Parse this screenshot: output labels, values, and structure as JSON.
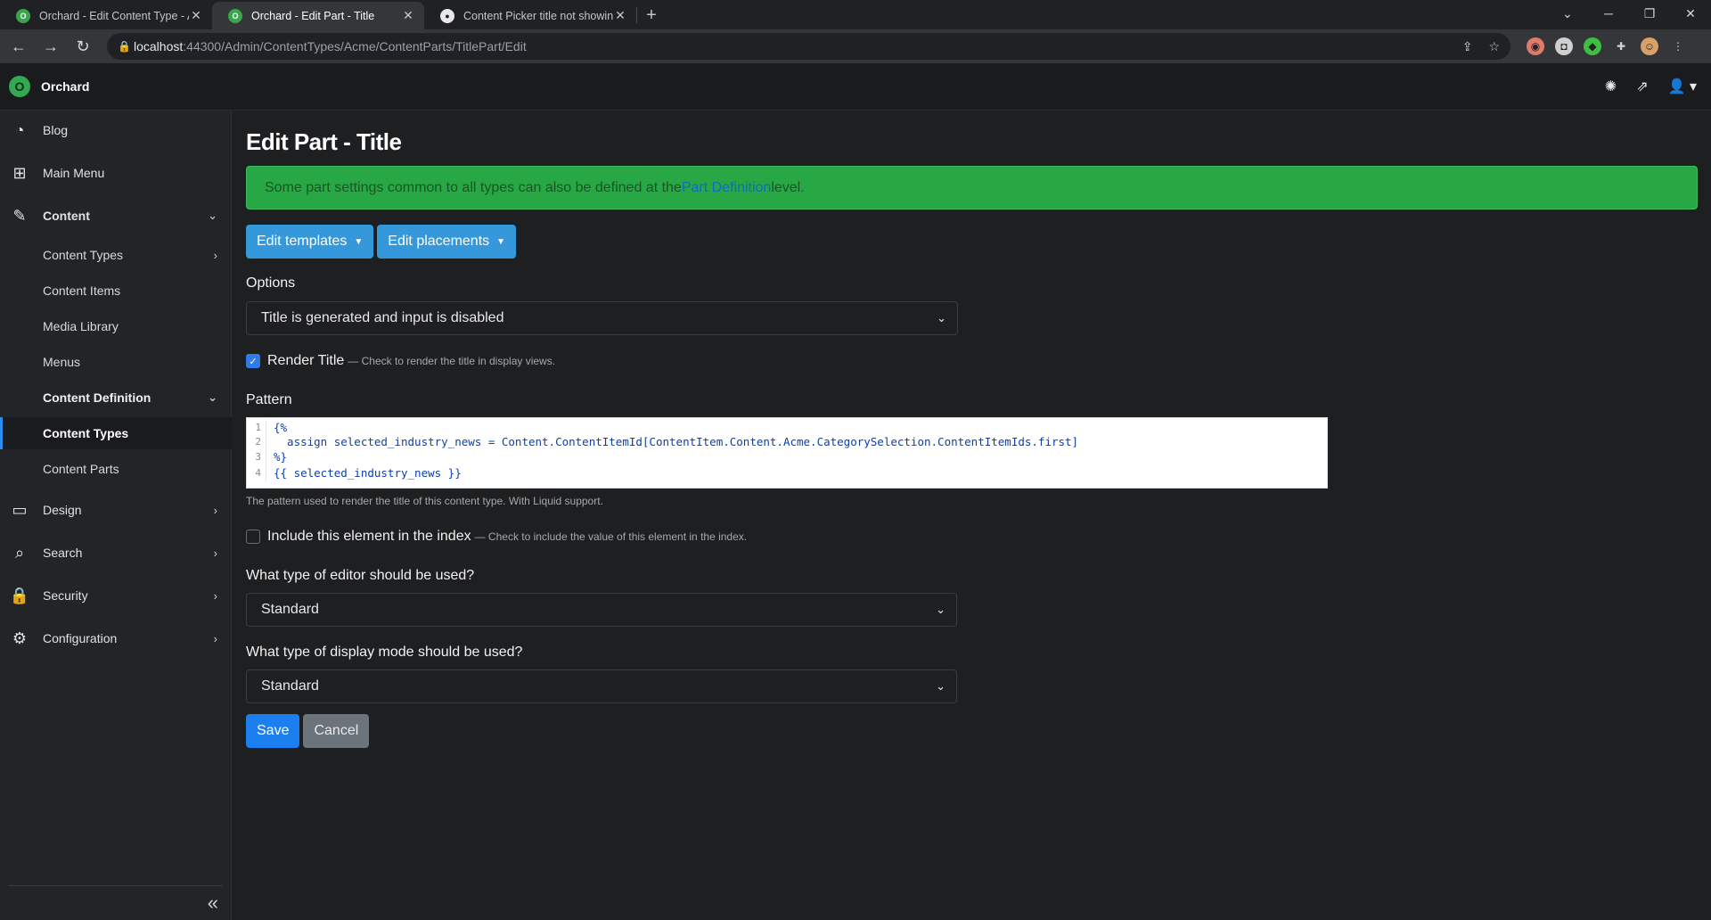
{
  "browser": {
    "tabs": [
      {
        "title": "Orchard - Edit Content Type - Ac",
        "icon": "orchard-favicon"
      },
      {
        "title": "Orchard - Edit Part - Title",
        "icon": "orchard-favicon"
      },
      {
        "title": "Content Picker title not showing",
        "icon": "github-icon"
      }
    ],
    "url_host": "localhost",
    "url_path": ":44300/Admin/ContentTypes/Acme/ContentParts/TitlePart/Edit"
  },
  "app": {
    "brand": "Orchard"
  },
  "sidebar": {
    "items": [
      {
        "label": "Blog",
        "icon": "rss-icon"
      },
      {
        "label": "Main Menu",
        "icon": "sitemap-icon"
      },
      {
        "label": "Content",
        "icon": "edit-icon"
      },
      {
        "label": "Design",
        "icon": "monitor-icon"
      },
      {
        "label": "Search",
        "icon": "search-icon"
      },
      {
        "label": "Security",
        "icon": "lock-icon"
      },
      {
        "label": "Configuration",
        "icon": "gear-icon"
      }
    ],
    "content_sub": [
      "Content Types",
      "Content Items",
      "Media Library",
      "Menus",
      "Content Definition"
    ],
    "definition_sub": [
      "Content Types",
      "Content Parts"
    ]
  },
  "main": {
    "title": "Edit Part - Title",
    "alert_pre": "Some part settings common to all types can also be defined at the ",
    "alert_link": "Part Definition",
    "alert_post": " level.",
    "edit_templates": "Edit templates",
    "edit_placements": "Edit placements",
    "options_label": "Options",
    "options_value": "Title is generated and input is disabled",
    "render_title_label": "Render Title",
    "render_title_hint": "— Check to render the title in display views.",
    "render_title_checked": true,
    "pattern_label": "Pattern",
    "pattern_lines": [
      {
        "n": "1",
        "text": "{%"
      },
      {
        "n": "2",
        "text": "  assign selected_industry_news = Content.ContentItemId[ContentItem.Content.Acme.CategorySelection.ContentItemIds.first]"
      },
      {
        "n": "3",
        "text": "%}"
      },
      {
        "n": "4",
        "text": "{{ selected_industry_news }}"
      }
    ],
    "pattern_help": "The pattern used to render the title of this content type. With Liquid support.",
    "index_label": "Include this element in the index",
    "index_hint": "— Check to include the value of this element in the index.",
    "index_checked": false,
    "editor_label": "What type of editor should be used?",
    "editor_value": "Standard",
    "display_label": "What type of display mode should be used?",
    "display_value": "Standard",
    "save": "Save",
    "cancel": "Cancel"
  }
}
